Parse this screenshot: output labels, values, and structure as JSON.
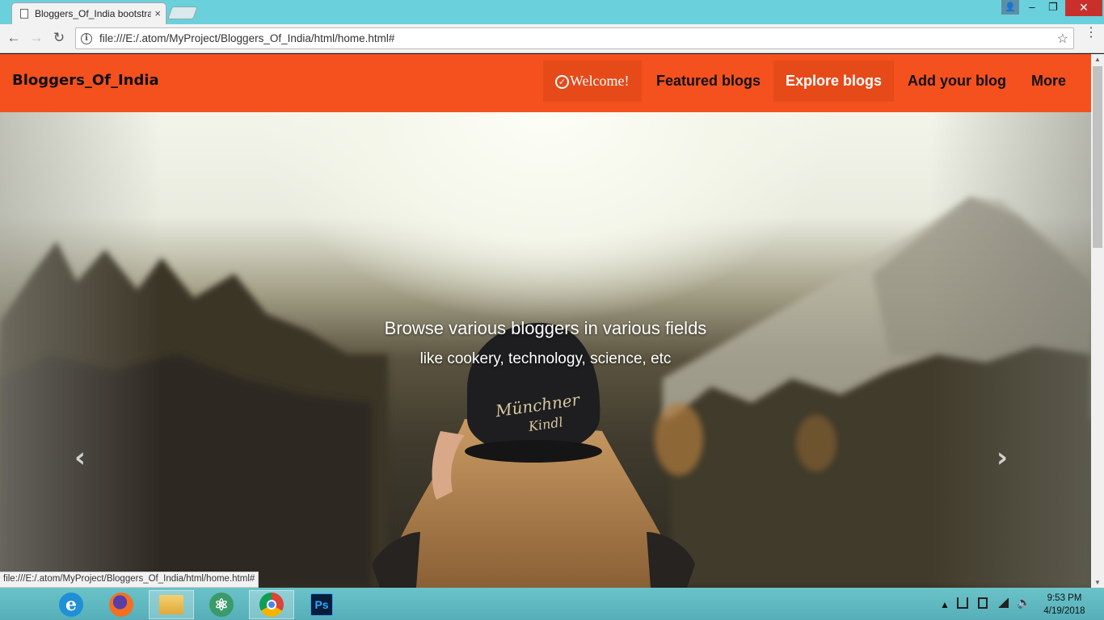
{
  "browser": {
    "tab_title": "Bloggers_Of_India bootstrap",
    "tab_close": "×",
    "url": "file:///E:/.atom/MyProject/Bloggers_Of_India/html/home.html#",
    "status_url": "file:///E:/.atom/MyProject/Bloggers_Of_India/html/home.html#",
    "back_glyph": "←",
    "forward_glyph": "→",
    "reload_glyph": "↻",
    "star_glyph": "☆",
    "menu_glyph": "⋮"
  },
  "window": {
    "user_glyph": "👤",
    "minimize": "–",
    "restore": "❐",
    "close": "✕"
  },
  "navbar": {
    "brand": "Bloggers_Of_India",
    "welcome": "Welcome!",
    "welcome_icon": "✓",
    "featured": "Featured blogs",
    "explore": "Explore blogs",
    "add": "Add your blog",
    "more": "More",
    "bg_color": "#f4511e"
  },
  "hero": {
    "title": "Browse various bloggers in various fields",
    "subtitle": "like cookery, technology, science, etc",
    "prev": "‹",
    "next": "›"
  },
  "taskbar": {
    "apps": [
      {
        "name": "internet-explorer",
        "glyph": "e"
      },
      {
        "name": "firefox",
        "glyph": ""
      },
      {
        "name": "file-explorer",
        "glyph": ""
      },
      {
        "name": "atom",
        "glyph": "⚛"
      },
      {
        "name": "chrome",
        "glyph": ""
      },
      {
        "name": "photoshop",
        "glyph": "Ps"
      }
    ],
    "tray_up": "▲",
    "tray_volume": "🔈",
    "time": "9:53 PM",
    "date": "4/19/2018"
  }
}
